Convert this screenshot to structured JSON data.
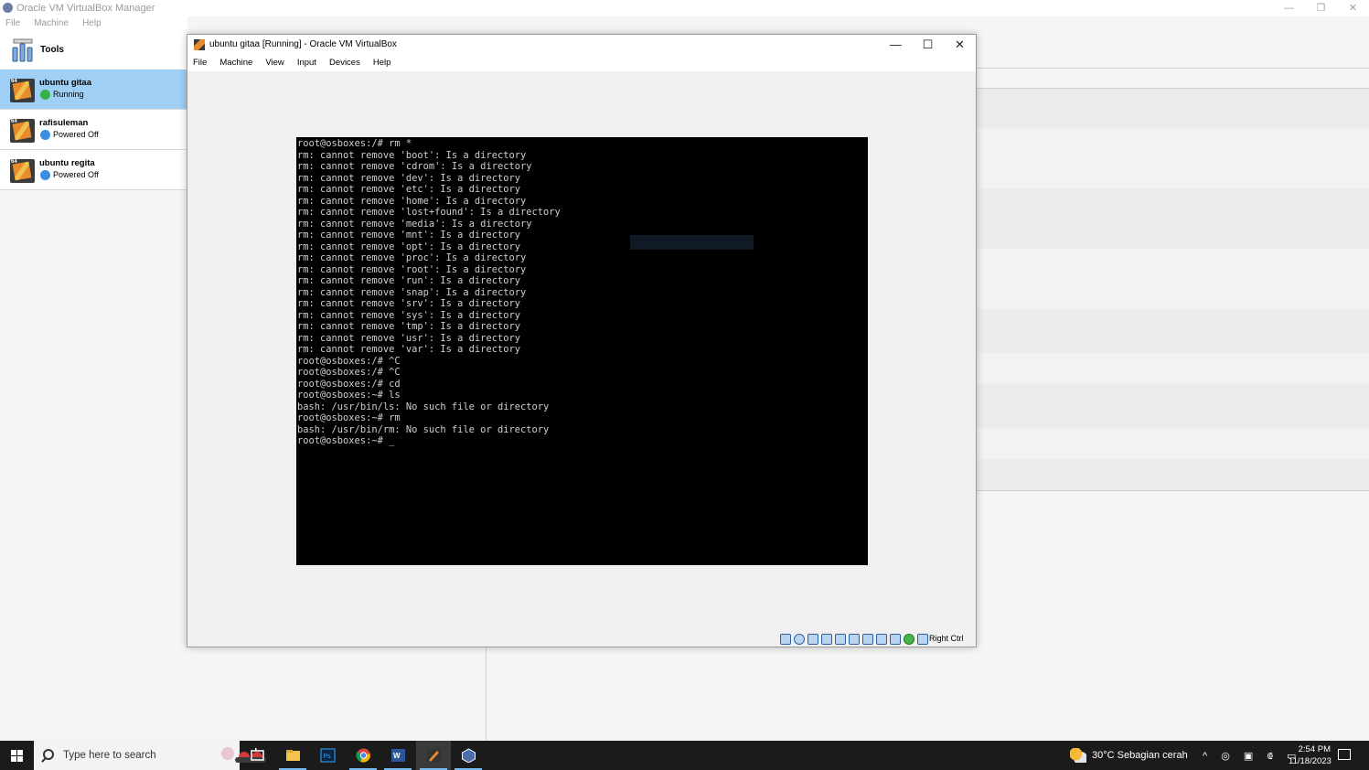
{
  "manager": {
    "title": "Oracle VM VirtualBox Manager",
    "menu": [
      "File",
      "Machine",
      "Help"
    ],
    "window_controls": [
      "—",
      "❐",
      "✕"
    ],
    "tools_label": "Tools",
    "vms": [
      {
        "name": "ubuntu gitaa",
        "state": "Running",
        "selected": true
      },
      {
        "name": "rafisuleman",
        "state": "Powered Off",
        "selected": false
      },
      {
        "name": "ubuntu regita",
        "state": "Powered Off",
        "selected": false
      }
    ]
  },
  "vm_window": {
    "title": "ubuntu gitaa [Running] - Oracle VM VirtualBox",
    "menu": [
      "File",
      "Machine",
      "View",
      "Input",
      "Devices",
      "Help"
    ],
    "window_controls": [
      "—",
      "☐",
      "✕"
    ],
    "host_key": "Right Ctrl",
    "status_icons": [
      "hard-disk-icon",
      "optical-drive-icon",
      "audio-icon",
      "network-icon",
      "usb-icon",
      "shared-folder-icon",
      "display-icon",
      "video-capture-icon",
      "cpu-icon",
      "mouse-integration-icon",
      "keyboard-icon"
    ]
  },
  "terminal": {
    "lines": [
      "root@osboxes:/# rm *",
      "rm: cannot remove 'boot': Is a directory",
      "rm: cannot remove 'cdrom': Is a directory",
      "rm: cannot remove 'dev': Is a directory",
      "rm: cannot remove 'etc': Is a directory",
      "rm: cannot remove 'home': Is a directory",
      "rm: cannot remove 'lost+found': Is a directory",
      "rm: cannot remove 'media': Is a directory",
      "rm: cannot remove 'mnt': Is a directory",
      "rm: cannot remove 'opt': Is a directory",
      "rm: cannot remove 'proc': Is a directory",
      "rm: cannot remove 'root': Is a directory",
      "rm: cannot remove 'run': Is a directory",
      "rm: cannot remove 'snap': Is a directory",
      "rm: cannot remove 'srv': Is a directory",
      "rm: cannot remove 'sys': Is a directory",
      "rm: cannot remove 'tmp': Is a directory",
      "rm: cannot remove 'usr': Is a directory",
      "rm: cannot remove 'var': Is a directory",
      "root@osboxes:/# ^C",
      "root@osboxes:/# ^C",
      "root@osboxes:/# cd",
      "root@osboxes:~# ls",
      "bash: /usr/bin/ls: No such file or directory",
      "root@osboxes:~# rm",
      "bash: /usr/bin/rm: No such file or directory",
      "root@osboxes:~# _"
    ]
  },
  "taskbar": {
    "search_placeholder": "Type here to search",
    "apps": [
      {
        "name": "task-view-icon",
        "active": false
      },
      {
        "name": "file-explorer-icon",
        "active": true
      },
      {
        "name": "photoshop-icon",
        "active": false
      },
      {
        "name": "chrome-icon",
        "active": true
      },
      {
        "name": "word-icon",
        "active": true
      },
      {
        "name": "virtualbox-vm-icon",
        "active": true
      },
      {
        "name": "virtualbox-manager-icon",
        "active": true
      }
    ],
    "weather": "30°C  Sebagian cerah",
    "time": "2:54 PM",
    "date": "11/18/2023",
    "colors": {
      "accent": "#76b9ed",
      "bar": "#1b1b1b",
      "selection": "#9fcff5"
    }
  }
}
